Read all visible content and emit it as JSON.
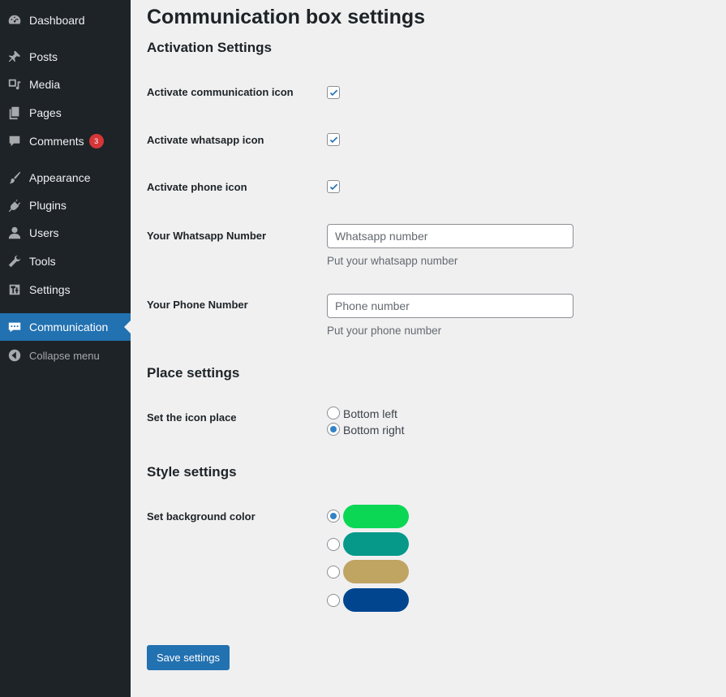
{
  "sidebar": {
    "items": [
      {
        "label": "Dashboard",
        "icon": "dashboard-icon"
      },
      {
        "label": "Posts",
        "icon": "pin-icon"
      },
      {
        "label": "Media",
        "icon": "media-icon"
      },
      {
        "label": "Pages",
        "icon": "pages-icon"
      },
      {
        "label": "Comments",
        "icon": "comment-icon",
        "badge": "3"
      },
      {
        "label": "Appearance",
        "icon": "brush-icon"
      },
      {
        "label": "Plugins",
        "icon": "plugin-icon"
      },
      {
        "label": "Users",
        "icon": "user-icon"
      },
      {
        "label": "Tools",
        "icon": "wrench-icon"
      },
      {
        "label": "Settings",
        "icon": "settings-icon"
      },
      {
        "label": "Communication",
        "icon": "communication-icon",
        "active": true
      },
      {
        "label": "Collapse menu",
        "icon": "collapse-icon"
      }
    ]
  },
  "page": {
    "title": "Communication box settings",
    "activation": {
      "title": "Activation Settings",
      "communication_label": "Activate communication icon",
      "communication_checked": true,
      "whatsapp_label": "Activate whatsapp icon",
      "whatsapp_checked": true,
      "phone_label": "Activate phone icon",
      "phone_checked": true,
      "whatsapp_number_label": "Your Whatsapp Number",
      "whatsapp_number_placeholder": "Whatsapp number",
      "whatsapp_number_value": "",
      "whatsapp_number_desc": "Put your whatsapp number",
      "phone_number_label": "Your Phone Number",
      "phone_number_placeholder": "Phone number",
      "phone_number_value": "",
      "phone_number_desc": "Put your phone number"
    },
    "place": {
      "title": "Place settings",
      "label": "Set the icon place",
      "options": [
        "Bottom left",
        "Bottom right"
      ],
      "selected": "Bottom right"
    },
    "style": {
      "title": "Style settings",
      "label": "Set background color",
      "colors": [
        "#0bd755",
        "#06998a",
        "#bfa462",
        "#02458f"
      ],
      "selected_index": 0
    },
    "save_label": "Save settings"
  },
  "colors": {
    "sidebar_bg": "#1d2327",
    "accent": "#2271b1",
    "page_bg": "#f0f0f1",
    "badge": "#d63638"
  }
}
